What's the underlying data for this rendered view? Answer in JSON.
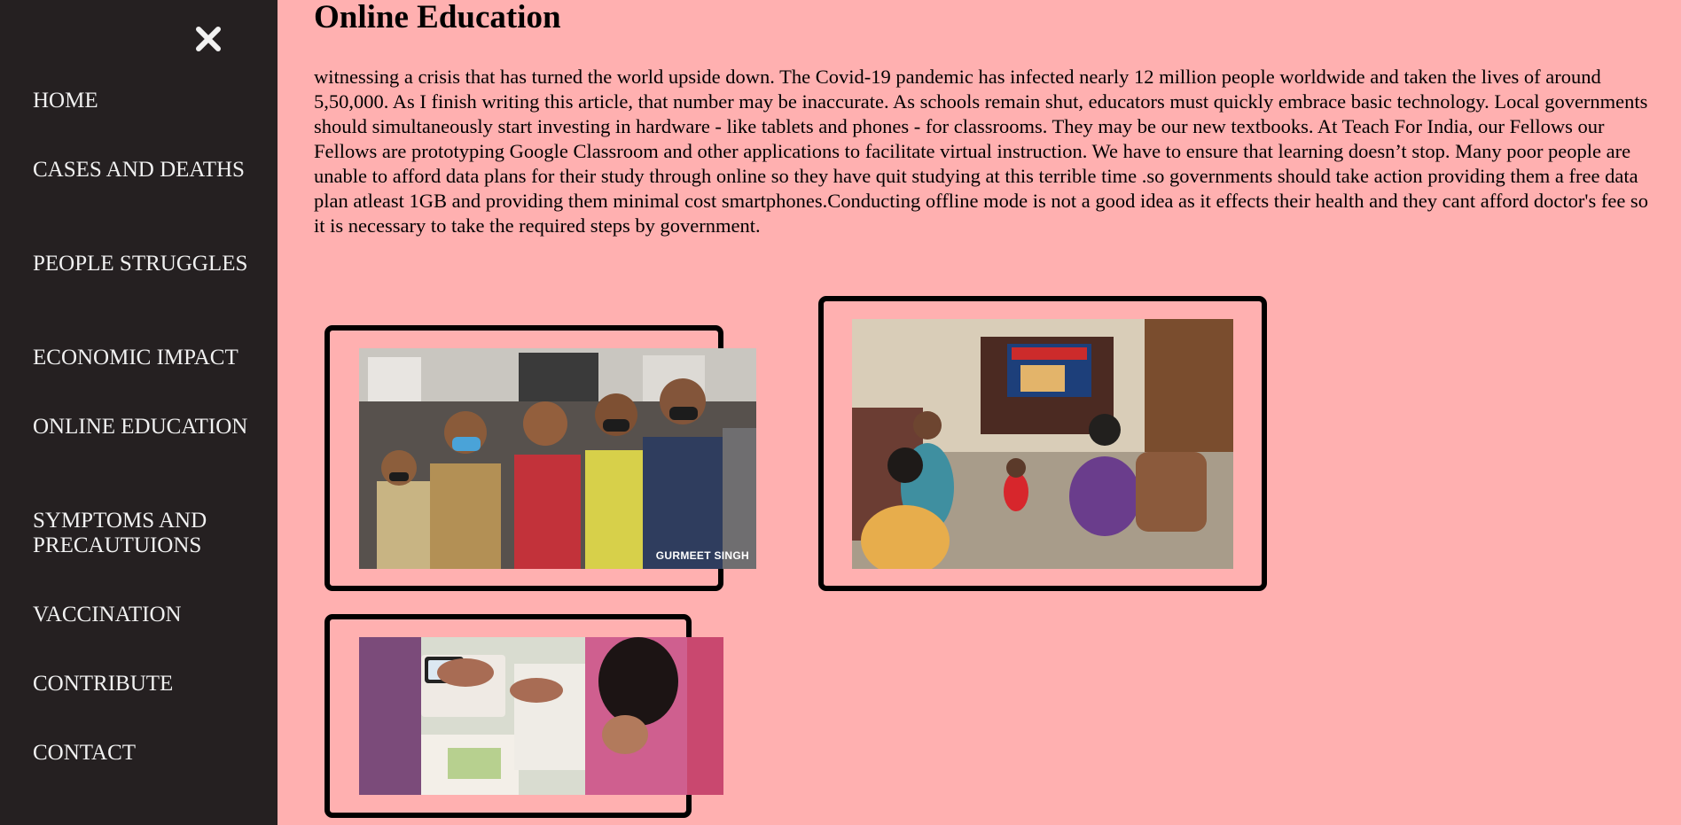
{
  "sidebar": {
    "close_icon": "close-icon",
    "items": [
      {
        "label": "HOME"
      },
      {
        "label": "CASES AND DEATHS"
      },
      {
        "label": "PEOPLE STRUGGLES"
      },
      {
        "label": "ECONOMIC IMPACT"
      },
      {
        "label": "ONLINE EDUCATION"
      },
      {
        "label": "SYMPTOMS AND PRECAUTUIONS"
      },
      {
        "label": "VACCINATION"
      },
      {
        "label": "CONTRIBUTE"
      },
      {
        "label": "CONTACT"
      }
    ]
  },
  "main": {
    "title": "Online Education",
    "body": "witnessing a crisis that has turned the world upside down. The Covid-19 pandemic has infected nearly 12 million people worldwide and taken the lives of around 5,50,000. As I finish writing this article, that number may be inaccurate. As schools remain shut, educators must quickly embrace basic technology. Local governments should simultaneously start investing in hardware - like tablets and phones - for classrooms. They may be our new textbooks. At Teach For India, our Fellows our Fellows are prototyping Google Classroom and other applications to facilitate virtual instruction. We have to ensure that learning doesn’t stop. Many poor people are unable to afford data plans for their study through online so they have quit studying at this terrible time .so governments should take action providing them a free data plan atleast 1GB and providing them minimal cost smartphones.Conducting offline mode is not a good idea as it effects their health and they cant afford doctor's fee so it is necessary to take the required steps by government.",
    "images": [
      {
        "watermark": "GURMEET SINGH"
      },
      {},
      {}
    ]
  },
  "colors": {
    "sidebar_bg": "#252021",
    "page_bg": "#ffb0b0",
    "nav_text": "#f1f1f1"
  }
}
